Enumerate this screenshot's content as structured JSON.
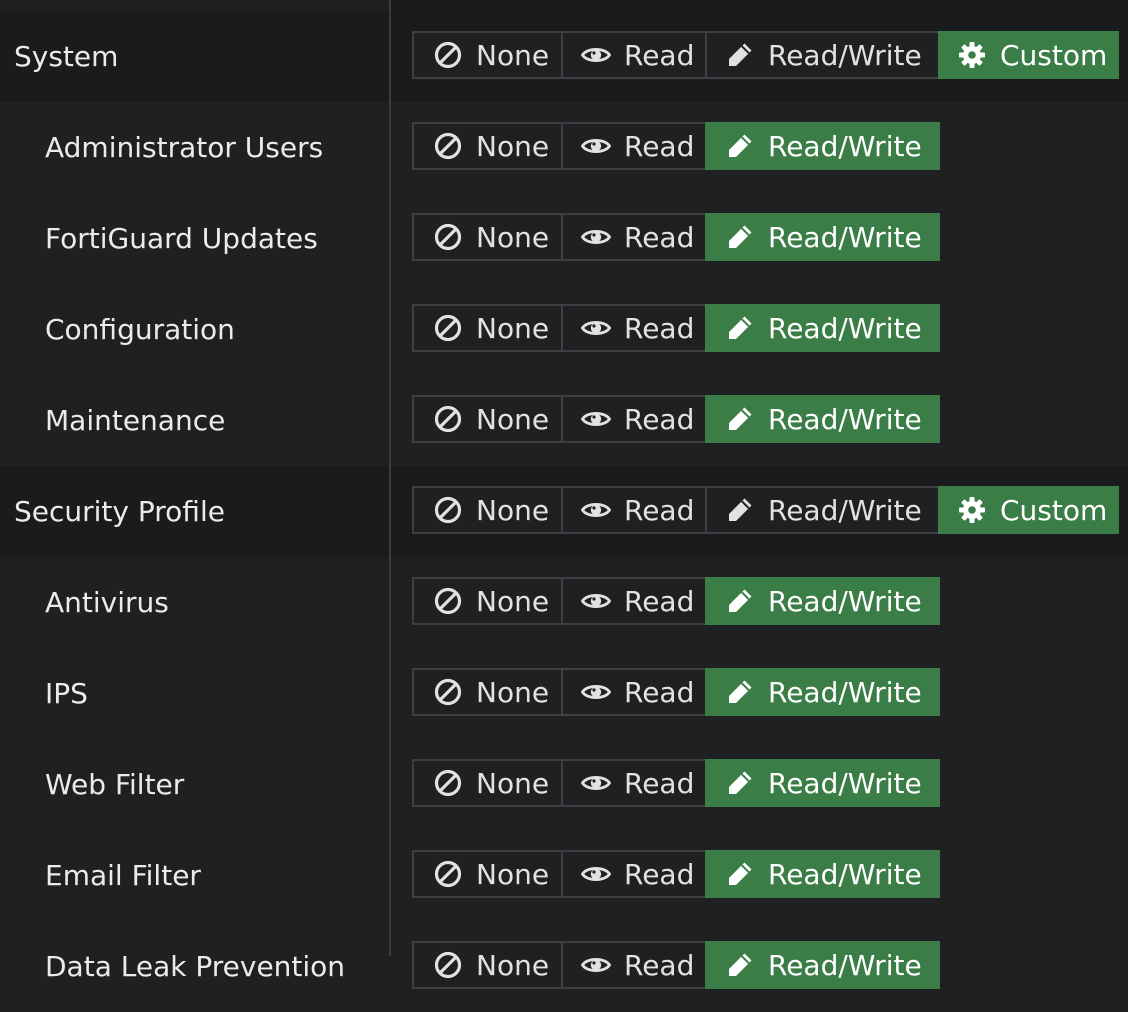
{
  "colors": {
    "background": "#1f2022",
    "group_background": "#1a1b1d",
    "active_green": "#3a7d46",
    "border": "#3d3f42"
  },
  "options": {
    "none": "None",
    "read": "Read",
    "read_write": "Read/Write",
    "custom": "Custom"
  },
  "icons": {
    "none": "ban-icon",
    "read": "eye-icon",
    "read_write": "pencil-icon",
    "custom": "gear-icon"
  },
  "rows": [
    {
      "label": "System",
      "type": "group",
      "selected": "custom"
    },
    {
      "label": "Administrator Users",
      "type": "child",
      "selected": "read_write"
    },
    {
      "label": "FortiGuard Updates",
      "type": "child",
      "selected": "read_write"
    },
    {
      "label": "Configuration",
      "type": "child",
      "selected": "read_write"
    },
    {
      "label": "Maintenance",
      "type": "child",
      "selected": "read_write"
    },
    {
      "label": "Security Profile",
      "type": "group",
      "selected": "custom"
    },
    {
      "label": "Antivirus",
      "type": "child",
      "selected": "read_write"
    },
    {
      "label": "IPS",
      "type": "child",
      "selected": "read_write"
    },
    {
      "label": "Web Filter",
      "type": "child",
      "selected": "read_write"
    },
    {
      "label": "Email Filter",
      "type": "child",
      "selected": "read_write"
    },
    {
      "label": "Data Leak Prevention",
      "type": "child",
      "selected": "read_write"
    }
  ]
}
